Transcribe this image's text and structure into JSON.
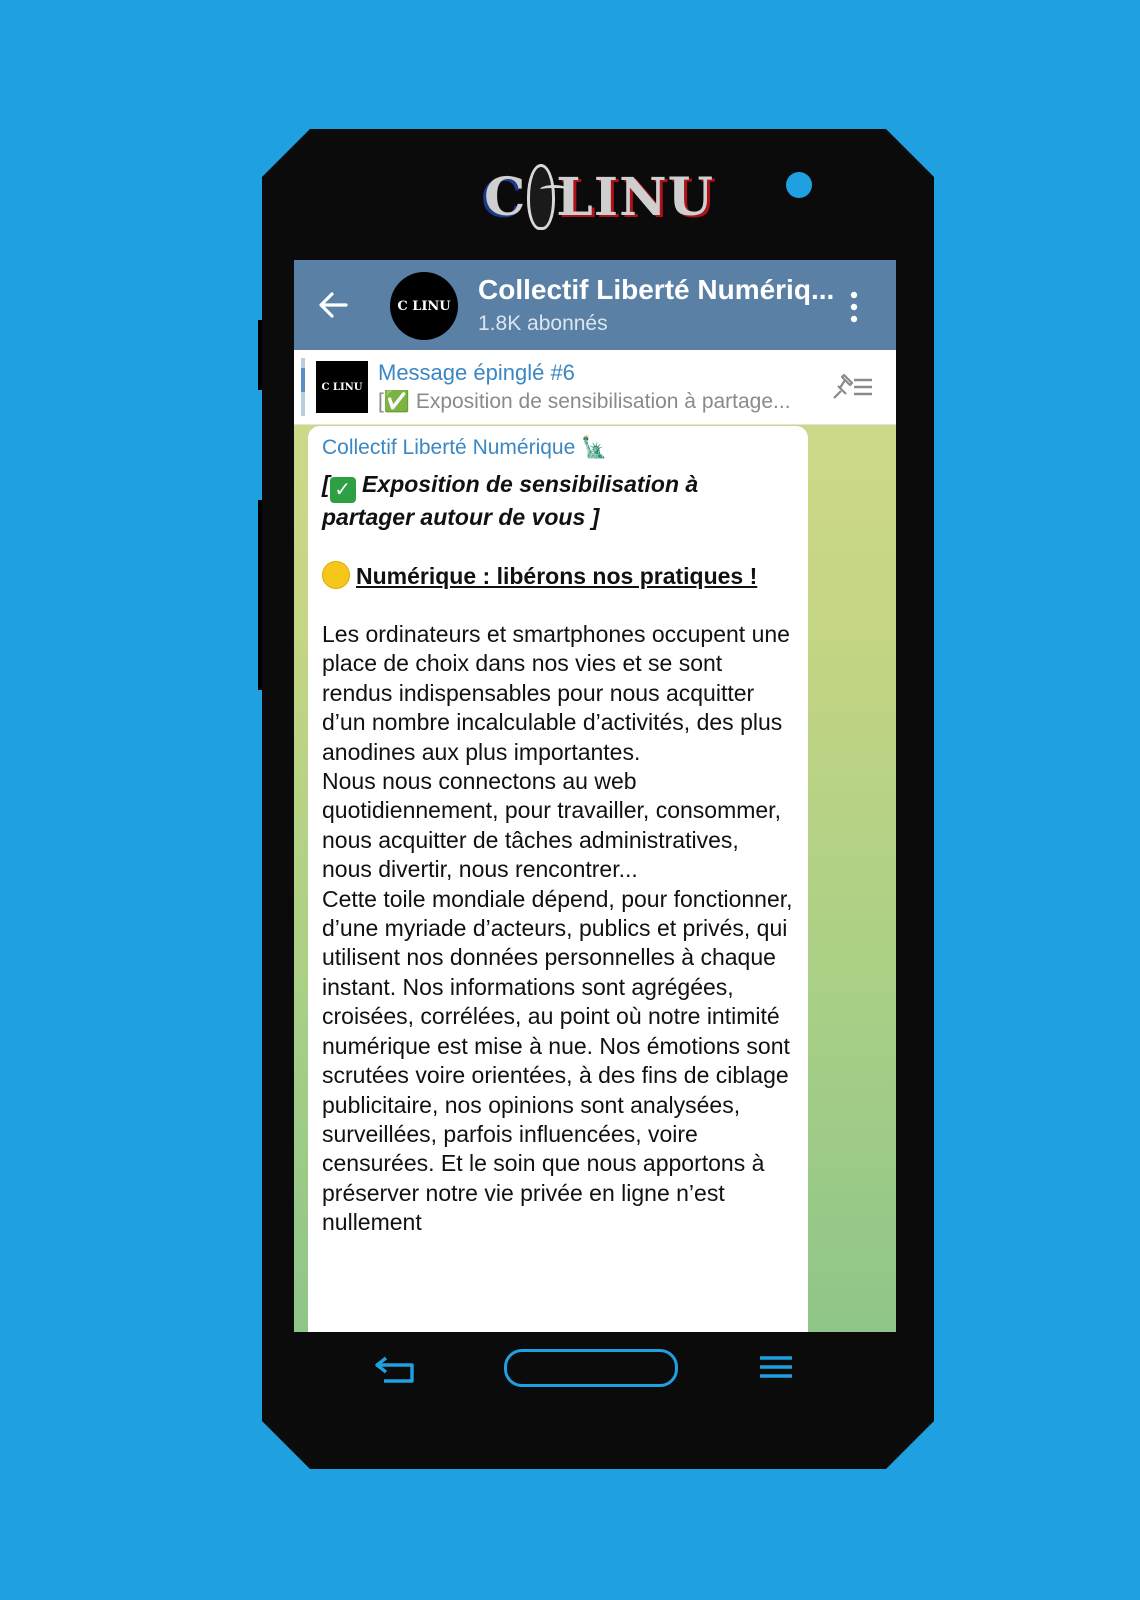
{
  "brand": {
    "logo_left": "C",
    "logo_right": "LINU"
  },
  "header": {
    "title": "Collectif Liberté Numériq...",
    "subtitle": "1.8K abonnés",
    "avatar_text": "C LINU"
  },
  "pinned": {
    "title": "Message épinglé #6",
    "preview": "[✅ Exposition de sensibilisation à partage...",
    "thumb_text": "C LINU"
  },
  "message": {
    "sender": "Collectif Liberté Numérique 🗽",
    "intro_open": "[",
    "intro_text": " Exposition de sensibilisation à partager autour de vous ]",
    "heading": "Numérique : libérons nos pratiques !",
    "body": "Les ordinateurs et smartphones occupent une place de choix dans nos vies et se sont rendus indispensables pour nous acquitter d’un nombre incalculable d’activités, des plus anodines aux plus importantes.\nNous nous connectons au web quotidiennement, pour travailler, consommer, nous acquitter de tâches administratives, nous divertir, nous rencontrer...\nCette toile mondiale dépend, pour fonctionner, d’une myriade d’acteurs, publics et privés, qui utilisent nos données personnelles à chaque instant. Nos informations sont agrégées, croisées, corrélées, au point où notre intimité numérique est mise à nue. Nos émotions sont scrutées voire orientées, à des fins de ciblage publicitaire, nos opinions sont analysées, surveillées, parfois influencées, voire censurées. Et le soin que nous apportons à préserver notre vie privée en ligne n’est nullement"
  },
  "colors": {
    "background": "#1fa0e0",
    "header": "#5a80a6",
    "link": "#3b87c4"
  },
  "icons": [
    "arrow-left-icon",
    "more-vert-icon",
    "pin-list-icon",
    "check-mark-icon",
    "yellow-circle-icon",
    "nav-back-icon",
    "nav-home-button",
    "nav-menu-icon"
  ]
}
